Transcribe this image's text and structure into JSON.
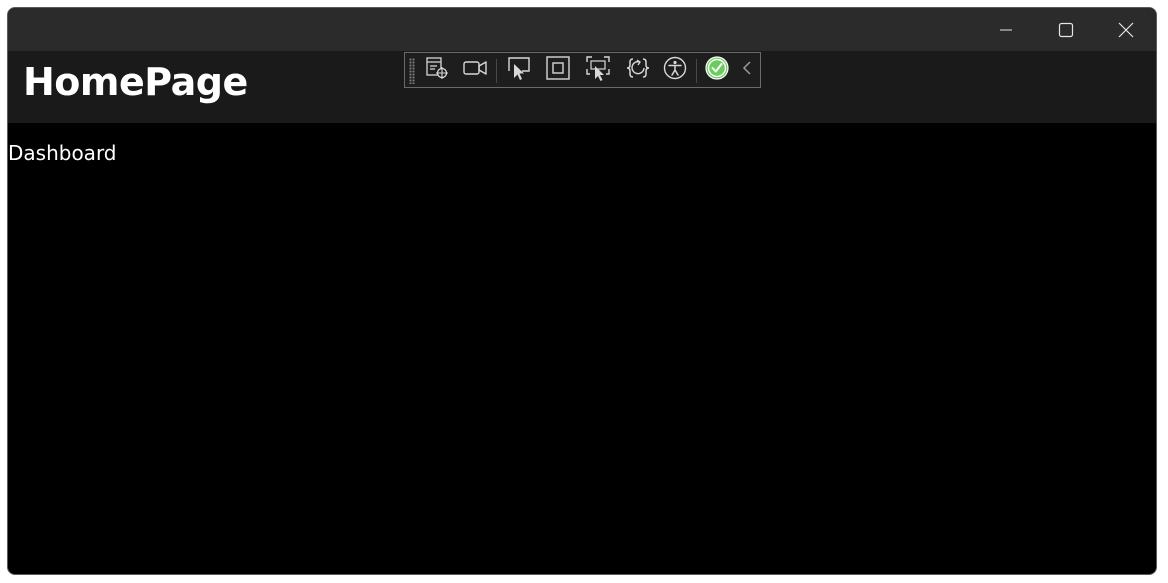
{
  "window": {
    "caption_buttons": {
      "minimize_icon": "minimize-icon",
      "maximize_icon": "maximize-icon",
      "close_icon": "close-icon"
    }
  },
  "header": {
    "title": "HomePage"
  },
  "dev_toolbar": {
    "items": [
      {
        "icon": "live-visual-tree-icon"
      },
      {
        "icon": "video-camera-icon"
      },
      {
        "icon": "select-element-icon"
      },
      {
        "icon": "display-layout-adorners-icon"
      },
      {
        "icon": "track-focused-element-icon"
      },
      {
        "icon": "hot-reload-icon"
      },
      {
        "icon": "accessibility-icon"
      },
      {
        "icon": "binding-failures-check-icon"
      },
      {
        "icon": "collapse-chevron-icon"
      }
    ],
    "accent_color": "#6ccb5f"
  },
  "main": {
    "text": "Dashboard"
  },
  "colors": {
    "titlebar": "#2b2b2b",
    "header": "#1a1a1a",
    "content": "#000000",
    "text": "#ffffff"
  }
}
